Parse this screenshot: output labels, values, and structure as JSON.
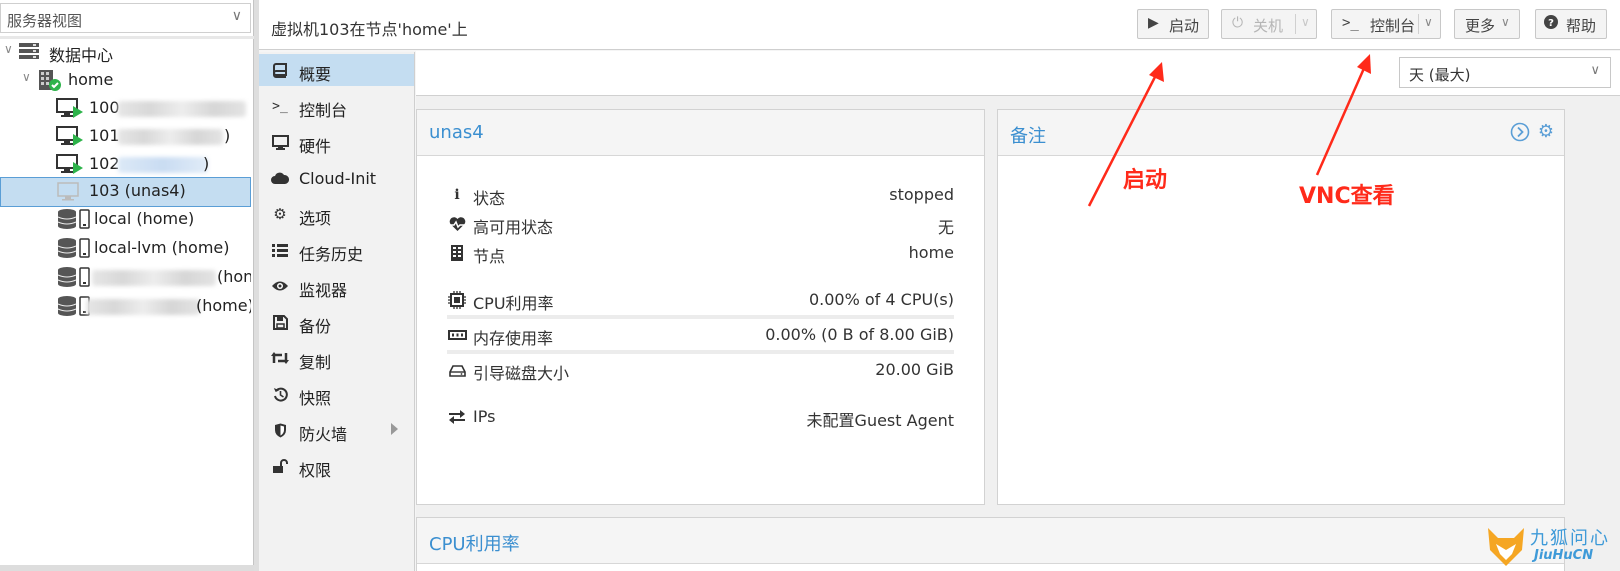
{
  "tree": {
    "view_select": "服务器视图",
    "datacenter": "数据中心",
    "node": "home",
    "vms": [
      {
        "id": "100",
        "suffix": ""
      },
      {
        "id": "101",
        "suffix": ")"
      },
      {
        "id": "102",
        "suffix": ")"
      },
      {
        "id": "103 (unas4)",
        "suffix": ""
      }
    ],
    "storages": [
      {
        "label": "local (home)"
      },
      {
        "label": "local-lvm (home)"
      },
      {
        "label": "(hon"
      },
      {
        "label": "(home)"
      }
    ]
  },
  "header": {
    "title": "虚拟机103在节点'home'上",
    "buttons": {
      "start": "启动",
      "shutdown": "关机",
      "console": "控制台",
      "more": "更多",
      "help": "帮助"
    }
  },
  "nav": {
    "items": [
      {
        "label": "概要",
        "icon": "book-icon"
      },
      {
        "label": "控制台",
        "icon": "terminal-icon"
      },
      {
        "label": "硬件",
        "icon": "monitor-icon"
      },
      {
        "label": "Cloud-Init",
        "icon": "cloud-icon"
      },
      {
        "label": "选项",
        "icon": "gear-icon"
      },
      {
        "label": "任务历史",
        "icon": "list-icon"
      },
      {
        "label": "监视器",
        "icon": "eye-icon"
      },
      {
        "label": "备份",
        "icon": "floppy-icon"
      },
      {
        "label": "复制",
        "icon": "retweet-icon"
      },
      {
        "label": "快照",
        "icon": "history-icon"
      },
      {
        "label": "防火墙",
        "icon": "shield-icon"
      },
      {
        "label": "权限",
        "icon": "unlock-icon"
      }
    ]
  },
  "timeframe": {
    "value": "天 (最大)"
  },
  "status_panel": {
    "title": "unas4",
    "rows": [
      {
        "label": "状态",
        "value": "stopped",
        "icon": "info-icon"
      },
      {
        "label": "高可用状态",
        "value": "无",
        "icon": "heartbeat-icon"
      },
      {
        "label": "节点",
        "value": "home",
        "icon": "building-icon"
      },
      {
        "label": "CPU利用率",
        "value": "0.00% of 4 CPU(s)",
        "icon": "cpu-icon",
        "usage": 0.0
      },
      {
        "label": "内存使用率",
        "value": "0.00% (0 B of 8.00 GiB)",
        "icon": "memory-icon",
        "usage": 0.0
      },
      {
        "label": "引导磁盘大小",
        "value": "20.00 GiB",
        "icon": "hdd-icon"
      },
      {
        "label": "IPs",
        "value": "未配置Guest Agent",
        "icon": "exchange-icon"
      }
    ]
  },
  "notes_panel": {
    "title": "备注"
  },
  "cpu_panel": {
    "title": "CPU利用率"
  },
  "annotations": {
    "start": "启动",
    "vnc": "VNC查看"
  },
  "watermark": {
    "cn": "九狐问心",
    "en": "JiuHuCN"
  },
  "colors": {
    "accent": "#3b8fd0",
    "selected": "#c4ddf1",
    "annotation": "#ff2a1a",
    "running": "#2db34a"
  }
}
